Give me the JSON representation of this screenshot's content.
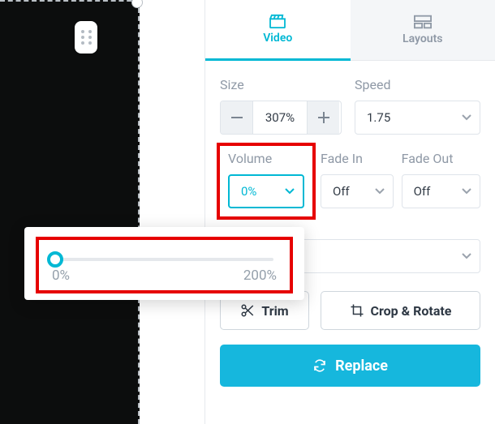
{
  "tabs": {
    "video": "Video",
    "layouts": "Layouts"
  },
  "size": {
    "label": "Size",
    "value": "307%"
  },
  "speed": {
    "label": "Speed",
    "value": "1.75"
  },
  "volume": {
    "label": "Volume",
    "value": "0%",
    "slider_min": "0%",
    "slider_max": "200%"
  },
  "fade_in": {
    "label": "Fade In",
    "value": "Off"
  },
  "fade_out": {
    "label": "Fade Out",
    "value": "Off"
  },
  "actions": {
    "trim": "Trim",
    "crop": "Crop & Rotate",
    "replace": "Replace"
  }
}
